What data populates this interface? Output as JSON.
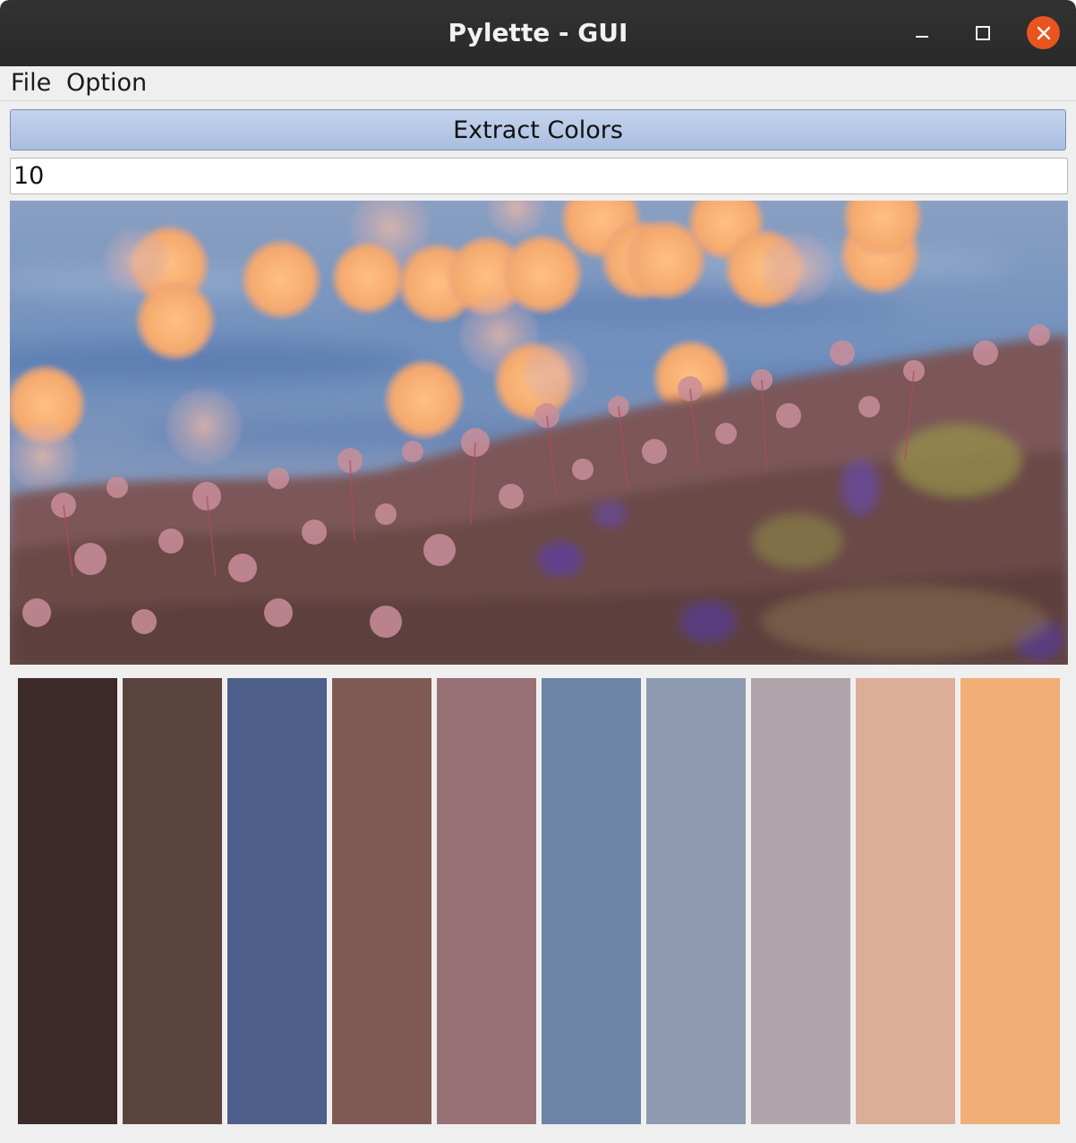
{
  "window": {
    "title": "Pylette - GUI"
  },
  "menu": {
    "items": [
      "File",
      "Option"
    ]
  },
  "extract_button": {
    "label": "Extract Colors"
  },
  "color_count_input": {
    "value": "10"
  },
  "palette": {
    "colors": [
      "#3d2a2b",
      "#5c443e",
      "#4d5f8a",
      "#7f5a55",
      "#977176",
      "#6c85a6",
      "#8d9ab0",
      "#b1a5ac",
      "#dcad99",
      "#f1ae75"
    ]
  }
}
